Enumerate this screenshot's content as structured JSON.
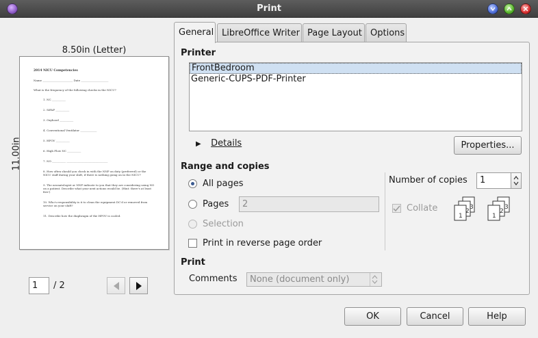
{
  "window": {
    "title": "Print"
  },
  "preview": {
    "paper_size": "8.50in (Letter)",
    "paper_height": "11.00in",
    "page_current": "1",
    "page_total": "/ 2",
    "doc": {
      "title": "2014 NICU Competencies",
      "name_line": "Name ______________________        Date ____________________",
      "question": "What is the frequency of the following checks in the NICU?",
      "items": [
        "1.   NC __________",
        "2.   SiPAP __________",
        "3.   Oxyhood __________",
        "4.   Conventional Ventilator ____________",
        "5.   HFOV __________",
        "6.   High Flow NC __________",
        "7.   NO __________   ______________________________",
        "8.   How often should you check in with the NNP on duty (preferred) or the NICU staff during your shift, if there is nothing going on in the NICU?",
        "9.   The neonatologist or NNP indicate to you that they are considering using NO on a patient. Describe what your next actions would be. (Hint: there's at least five!)",
        "10. Who's responsibility is it to clean the equipment DC'd or removed from service on your shift?",
        "11. Describe how the diaphragm of the HFOV is cooled."
      ]
    }
  },
  "tabs": [
    "General",
    "LibreOffice Writer",
    "Page Layout",
    "Options"
  ],
  "printer": {
    "section_title": "Printer",
    "items": [
      "FrontBedroom",
      "Generic-CUPS-PDF-Printer"
    ],
    "selected_index": 0,
    "details_label": "Details",
    "properties_button": "Properties..."
  },
  "range": {
    "section_title": "Range and copies",
    "all_pages": "All pages",
    "pages": "Pages",
    "pages_value": "2",
    "selection": "Selection",
    "reverse_order": "Print in reverse page order",
    "copies_label": "Number of copies",
    "copies_value": "1",
    "collate": "Collate"
  },
  "print": {
    "section_title": "Print",
    "comments_label": "Comments",
    "comments_value": "None (document only)"
  },
  "buttons": {
    "ok": "OK",
    "cancel": "Cancel",
    "help": "Help"
  },
  "colors": {
    "selection": "#cfe0f2",
    "titlebar": "#4b4b4b",
    "radio_dot": "#3a5a90"
  }
}
